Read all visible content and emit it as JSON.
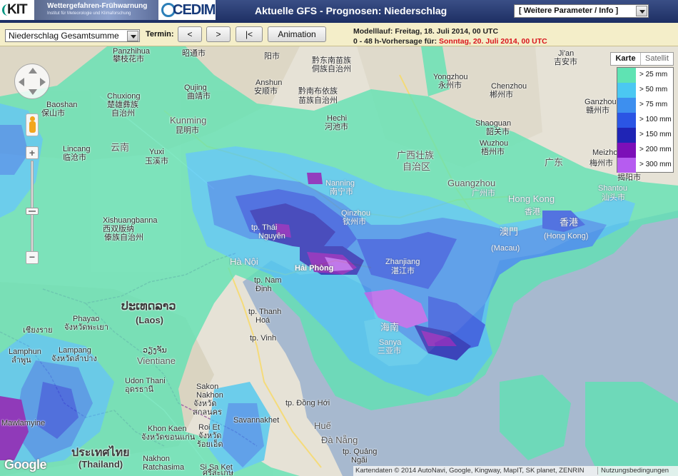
{
  "header": {
    "kit_logo": "KIT",
    "banner_title": "Wettergefahren-Frühwarnung",
    "banner_subtitle": "Institut für Meteorologie und Klimaforschung",
    "cedim_logo": "CEDIM",
    "title": "Aktuelle GFS - Prognosen: Niederschlag",
    "param_select": "[ Weitere Parameter / Info ]"
  },
  "toolbar": {
    "measure_select": "Niederschlag Gesamtsumme",
    "termin_label": "Termin:",
    "prev_label": "<",
    "next_label": ">",
    "first_label": "|<",
    "animation_label": "Animation",
    "run_text": "Modelllauf: Freitag, 18. Juli 2014, 00 UTC",
    "forecast_prefix": "0 - 48 h-Vorhersage für: ",
    "forecast_date": "Sonntag, 20. Juli 2014, 00 UTC"
  },
  "map": {
    "maptype_active": "Karte",
    "maptype_other": "Satellit",
    "zoom_in": "+",
    "zoom_out": "−",
    "zoom_mid": "−",
    "google": "Google",
    "attribution": "Kartendaten © 2014 AutoNavi, Google, Kingway, MapIT, SK planet, ZENRIN",
    "terms": "Nutzungsbedingungen",
    "legend": [
      {
        "label": "> 25 mm",
        "color": "#5fe3b3"
      },
      {
        "label": "> 50 mm",
        "color": "#4bc8f2"
      },
      {
        "label": "> 75 mm",
        "color": "#3d8fef"
      },
      {
        "label": "> 100 mm",
        "color": "#2b55e4"
      },
      {
        "label": "> 150 mm",
        "color": "#1f24b5"
      },
      {
        "label": "> 200 mm",
        "color": "#7c0fb8"
      },
      {
        "label": "> 300 mm",
        "color": "#b65cf0"
      }
    ],
    "places": {
      "zhaotong": "昭通市",
      "panzhihua_en": "Panzhihua",
      "panzhihua_zh": "攀枝花市",
      "chuxiong_en": "Chuxiong",
      "chuxiong_yi": "楚雄彝族",
      "chuxiong_zz": "自治州",
      "baoshan_en": "Baoshan",
      "baoshan_zh": "保山市",
      "kunming_en": "Kunming",
      "kunming_zh": "昆明市",
      "qujing_en": "Qujing",
      "qujing_zh": "曲靖市",
      "yunnan_zh": "云南",
      "yuxi_en": "Yuxi",
      "yuxi_zh": "玉溪市",
      "lincang_en": "Lincang",
      "lincang_zh": "临沧市",
      "anshun_en": "Anshun",
      "anshun_zh": "安顺市",
      "qiannan_1": "黔南布依族",
      "qiannan_2": "苗族自治州",
      "qiandongnan_1": "黔东南苗族",
      "qiandongnan_2": "侗族自治州",
      "guiyang_zh": "阳市",
      "hechi_en": "Hechi",
      "hechi_zh": "河池市",
      "yongzhou_en": "Yongzhou",
      "yongzhou_zh": "永州市",
      "chenzhou_en": "Chenzhou",
      "chenzhou_zh": "郴州市",
      "ji_an_en": "Ji'an",
      "ji_an_zh": "吉安市",
      "ganzhou_en": "Ganzhou",
      "ganzhou_zh": "赣州市",
      "shaoguan_en": "Shaoguan",
      "shaoguan_zh": "韶关市",
      "guangxi_1": "广西壮族",
      "guangxi_2": "自治区",
      "wuzhou_en": "Wuzhou",
      "wuzhou_zh": "梧州市",
      "guangdong_zh": "广东",
      "meizhou_en": "Meizhou",
      "meizhou_zh": "梅州市",
      "jieyang_zh": "揭阳市",
      "shantou_en": "Shantou",
      "shantou_zh": "汕头市",
      "nanning_en": "Nanning",
      "nanning_zh": "南宁市",
      "guangzhou_en": "Guangzhou",
      "guangzhou_zh": "广州市",
      "hongkong_en": "Hong Kong",
      "hongkong_zh": "香港",
      "hongkong_zh2": "香港",
      "hongkong_paren": "(Hong Kong)",
      "macau_zh": "澳門",
      "macau_paren": "(Macau)",
      "qinzhou_en": "Qinzhou",
      "qinzhou_zh": "钦州市",
      "thainguyen_1": "tp. Thái",
      "thainguyen_2": "Nguyên",
      "hanoi": "Hà Nội",
      "haiphong": "Hải Phòng",
      "namdinh_1": "tp. Nam",
      "namdinh_2": "Định",
      "thanhhoa_1": "tp. Thanh",
      "thanhhoa_2": "Hoá",
      "vinh": "tp. Vinh",
      "zhanjiang_en": "Zhanjiang",
      "zhanjiang_zh": "湛江市",
      "hainan_zh": "海南",
      "sanya_en": "Sanya",
      "sanya_zh": "三亚市",
      "xishuangbanna_en": "Xishuangbanna",
      "xishuangbanna_1": "西双版纳",
      "xishuangbanna_2": "傣族自治州",
      "laos_script": "ປະເທດລາວ",
      "laos": "(Laos)",
      "phayao_en": "Phayao",
      "phayao_th": "จังหวัดพะเยา",
      "chiangrai_th": "เชียงราย",
      "lamphun_en": "Lamphun",
      "lamphun_th": "ลำพูน",
      "lampang_en": "Lampang",
      "lampang_th": "จังหวัดลำปาง",
      "vientiane_script": "ວຽງຈັນ",
      "vientiane": "Vientiane",
      "udon_1": "Udon Thani",
      "udon_2": "อุดรธานี",
      "sakon_1": "Sakon",
      "sakon_2": "Nakhon",
      "sakon_3": "จังหวัด",
      "sakon_4": "สกลนคร",
      "savannakhet": "Savannakhet",
      "khonkaen_1": "Khon Kaen",
      "khonkaen_2": "จังหวัดขอนแก่น",
      "roiet_1": "Roi Et",
      "roiet_2": "จังหวัด",
      "roiet_3": "ร้อยเอ็ด",
      "donghoi": "tp. Đồng Hới",
      "hue": "Huế",
      "danang": "Đà Nẵng",
      "quangngai_1": "tp. Quảng",
      "quangngai_2": "Ngãi",
      "thailand_script": "ประเทศไทย",
      "thailand": "(Thailand)",
      "nakhon_1": "Nakhon",
      "nakhon_2": "Ratchasima",
      "sisaket_1": "Si Sa Ket",
      "sisaket_2": "ศรีสะเกษ",
      "mawlamyine": "Mawlamyine"
    }
  }
}
